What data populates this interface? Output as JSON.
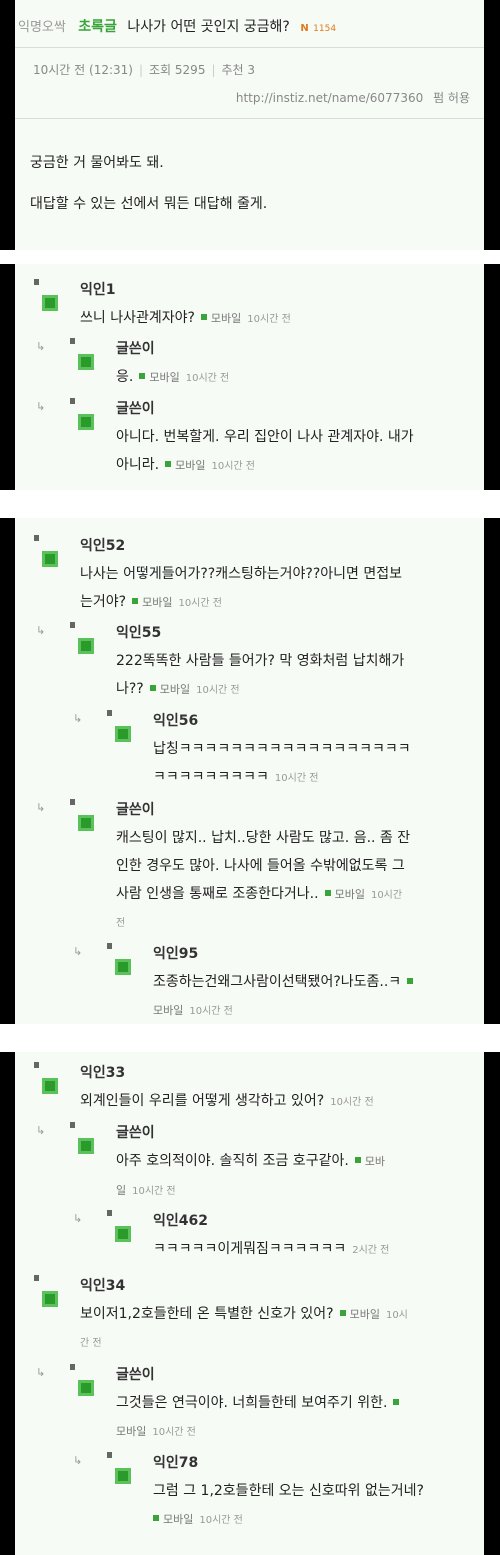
{
  "post": {
    "board": "익명오싹",
    "category": "초록글",
    "title": "나사가 어떤 곳인지 궁금해?",
    "badge_new": "N",
    "view_badge": "1154",
    "date": "10시간 전 (12:31)",
    "views": "조회 5295",
    "recommend": "추천 3",
    "url": "http://instiz.net/name/6077360",
    "perm": "펌 허용",
    "body": [
      "궁금한 거 물어봐도 돼.",
      "대답할 수 있는 선에서 뭐든 대답해 줄게."
    ]
  },
  "labels": {
    "mobile": "모바일",
    "reply_arrow": "↳"
  },
  "comments": [
    {
      "name": "익인1",
      "lines": [
        "쓰니 나사관계자야?"
      ],
      "time": "10시간 전"
    },
    {
      "name": "글쓴이",
      "lines": [
        "응."
      ],
      "time": "10시간 전"
    },
    {
      "name": "글쓴이",
      "lines": [
        "아니다. 번복할게. 우리 집안이 나사 관계자야. 내가",
        "아니라."
      ],
      "time": "10시간 전"
    },
    {
      "name": "익인52",
      "lines": [
        "나사는 어떻게들어가??캐스팅하는거야??아니면 면접보",
        "는거야?"
      ],
      "time": "10시간 전"
    },
    {
      "name": "익인55",
      "lines": [
        "222똑똑한 사람들 들어가? 막 영화처럼 납치해가",
        "나??"
      ],
      "time": "10시간 전"
    },
    {
      "name": "익인56",
      "lines": [
        "납칭ㅋㅋㅋㅋㅋㅋㅋㅋㅋㅋㅋㅋㅋㅋㅋㅋㅋㅋ",
        "ㅋㅋㅋㅋㅋㅋㅋㅋㅋ"
      ],
      "time": "10시간 전"
    },
    {
      "name": "글쓴이",
      "lines": [
        "캐스팅이 많지.. 납치..당한 사람도 많고. 음.. 좀 잔",
        "인한 경우도 많아. 나사에 들어올 수밖에없도록 그",
        "사람 인생을 통째로 조종한다거나..",
        "전"
      ],
      "time": "10시간"
    },
    {
      "name": "익인95",
      "lines": [
        "조종하는건왜그사람이선택됐어?나도좀..ㅋ",
        ""
      ],
      "time": "10시간 전"
    },
    {
      "name": "익인33",
      "lines": [
        "외계인들이 우리를 어떻게 생각하고 있어?"
      ],
      "time": "10시간 전"
    },
    {
      "name": "글쓴이",
      "lines": [
        "아주 호의적이야. 솔직히 조금 호구같아.",
        "일"
      ],
      "time": "10시간 전"
    },
    {
      "name": "익인462",
      "lines": [
        "ㅋㅋㅋㅋㅋ이게뭐짐ㅋㅋㅋㅋㅋㅋ"
      ],
      "time": "2시간 전"
    },
    {
      "name": "익인34",
      "lines": [
        "보이저1,2호들한테 온 특별한 신호가 있어?",
        "간 전"
      ],
      "time": "10시"
    },
    {
      "name": "글쓴이",
      "lines": [
        "그것들은 연극이야. 너희들한테 보여주기 위한.",
        ""
      ],
      "time": "10시간 전"
    },
    {
      "name": "익인78",
      "lines": [
        "그럼 그 1,2호들한테 오는 신호따위 없는거네?",
        ""
      ],
      "time": "10시간 전"
    }
  ],
  "split_labels": {
    "mobile_start": "모바",
    "mobile_end": "일"
  }
}
